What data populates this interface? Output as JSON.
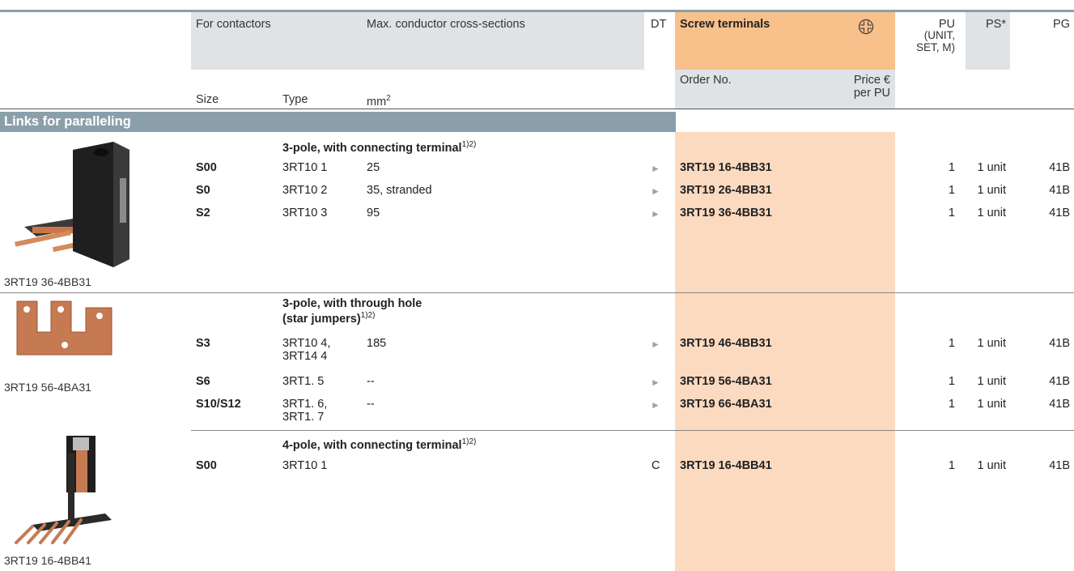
{
  "header": {
    "for_contactors": "For contactors",
    "max_conductor": "Max. conductor cross-sections",
    "dt": "DT",
    "screw_terminals": "Screw terminals",
    "pu": "PU",
    "pu_sub1": "(UNIT,",
    "pu_sub2": "SET, M)",
    "ps": "PS*",
    "pg": "PG",
    "size": "Size",
    "type": "Type",
    "mm": "mm",
    "mm_sup": "2",
    "order_no": "Order No.",
    "price": "Price €",
    "per_pu": "per PU",
    "screw_icon": "screw-terminal-icon"
  },
  "section": {
    "title": "Links for paralleling"
  },
  "groups": [
    {
      "heading": "3-pole, with connecting terminal",
      "heading_sup": "1)2)",
      "caption": "3RT19 36-4BB31",
      "rows": [
        {
          "size": "S00",
          "type": "3RT10 1",
          "mm": "25",
          "dt": "►",
          "order": "3RT19 16-4BB31",
          "pu": "1",
          "ps": "1 unit",
          "pg": "41B"
        },
        {
          "size": "S0",
          "type": "3RT10 2",
          "mm": "35, stranded",
          "dt": "►",
          "order": "3RT19 26-4BB31",
          "pu": "1",
          "ps": "1 unit",
          "pg": "41B"
        },
        {
          "size": "S2",
          "type": "3RT10 3",
          "mm": "95",
          "dt": "►",
          "order": "3RT19 36-4BB31",
          "pu": "1",
          "ps": "1 unit",
          "pg": "41B"
        }
      ]
    },
    {
      "heading_line1": "3-pole, with through hole",
      "heading_line2": "(star jumpers)",
      "heading_sup": "1)2)",
      "caption": "3RT19 56-4BA31",
      "rows": [
        {
          "size": "S3",
          "type": "3RT10 4,",
          "type2": "3RT14 4",
          "mm": "185",
          "dt": "►",
          "order": "3RT19 46-4BB31",
          "pu": "1",
          "ps": "1 unit",
          "pg": "41B"
        },
        {
          "size": "S6",
          "type": "3RT1. 5",
          "mm": "--",
          "dt": "►",
          "order": "3RT19 56-4BA31",
          "pu": "1",
          "ps": "1 unit",
          "pg": "41B"
        },
        {
          "size": "S10/S12",
          "type": "3RT1. 6,",
          "type2": "3RT1. 7",
          "mm": "--",
          "dt": "►",
          "order": "3RT19 66-4BA31",
          "pu": "1",
          "ps": "1 unit",
          "pg": "41B"
        }
      ]
    },
    {
      "heading": "4-pole, with connecting terminal",
      "heading_sup": "1)2)",
      "caption": "3RT19 16-4BB41",
      "rows": [
        {
          "size": "S00",
          "type": "3RT10 1",
          "mm": "",
          "dt": "C",
          "order": "3RT19 16-4BB41",
          "pu": "1",
          "ps": "1 unit",
          "pg": "41B"
        }
      ]
    }
  ]
}
